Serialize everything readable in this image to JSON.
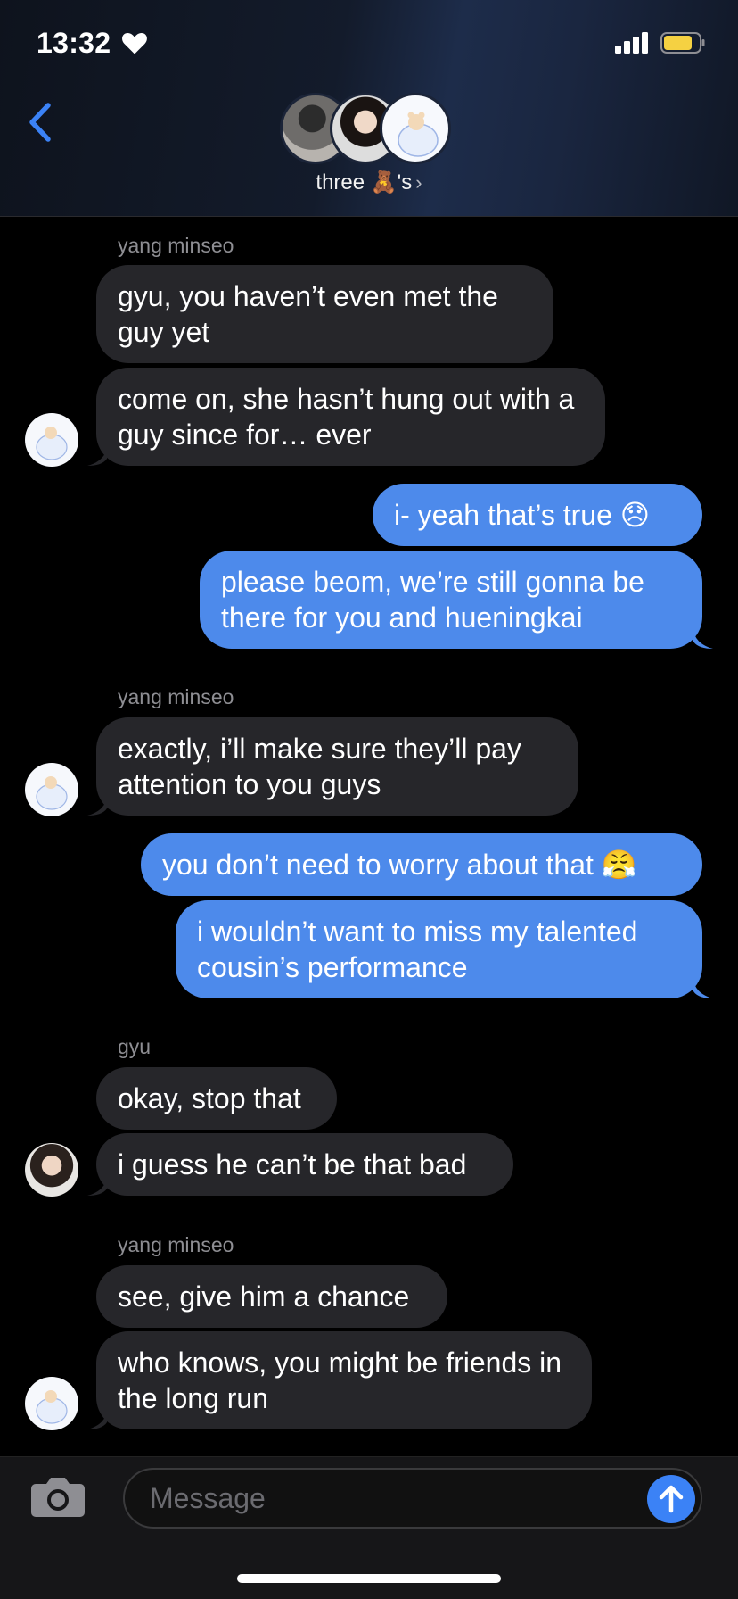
{
  "status_bar": {
    "time": "13:32",
    "heart_icon": "heart-icon",
    "signal_icon": "signal-icon",
    "battery_icon": "battery-icon",
    "battery_color": "#f5d142"
  },
  "header": {
    "back_icon": "chevron-left-icon",
    "group_name": "three 🧸's",
    "chevron": "›",
    "accent": "#3b82f6"
  },
  "messages": [
    {
      "sender": "yang minseo",
      "direction": "in",
      "text": "gyu, you haven’t even met the guy yet"
    },
    {
      "direction": "in",
      "text": "come on, she hasn’t hung out with a guy since for… ever"
    },
    {
      "direction": "out",
      "text": "i- yeah that’s true 😞"
    },
    {
      "direction": "out",
      "text": "please beom, we’re still gonna be there for you and hueningkai"
    },
    {
      "sender": "yang minseo",
      "direction": "in",
      "text": "exactly, i’ll make sure they’ll pay attention to you guys"
    },
    {
      "direction": "out",
      "text": "you don’t need to worry about that 😤"
    },
    {
      "direction": "out",
      "text": "i wouldn’t want to miss my talented cousin’s performance"
    },
    {
      "sender": "gyu",
      "direction": "in",
      "text": "okay, stop that"
    },
    {
      "direction": "in",
      "text": "i guess he can’t be that bad"
    },
    {
      "sender": "yang minseo",
      "direction": "in",
      "text": "see, give him a chance"
    },
    {
      "direction": "in",
      "text": "who knows, you might be friends in the long run"
    }
  ],
  "composer": {
    "placeholder": "Message",
    "camera_icon": "camera-icon",
    "send_icon": "arrow-up-icon"
  },
  "colors": {
    "incoming_bubble": "#26262a",
    "outgoing_bubble": "#4d8aeb",
    "background": "#000000"
  }
}
